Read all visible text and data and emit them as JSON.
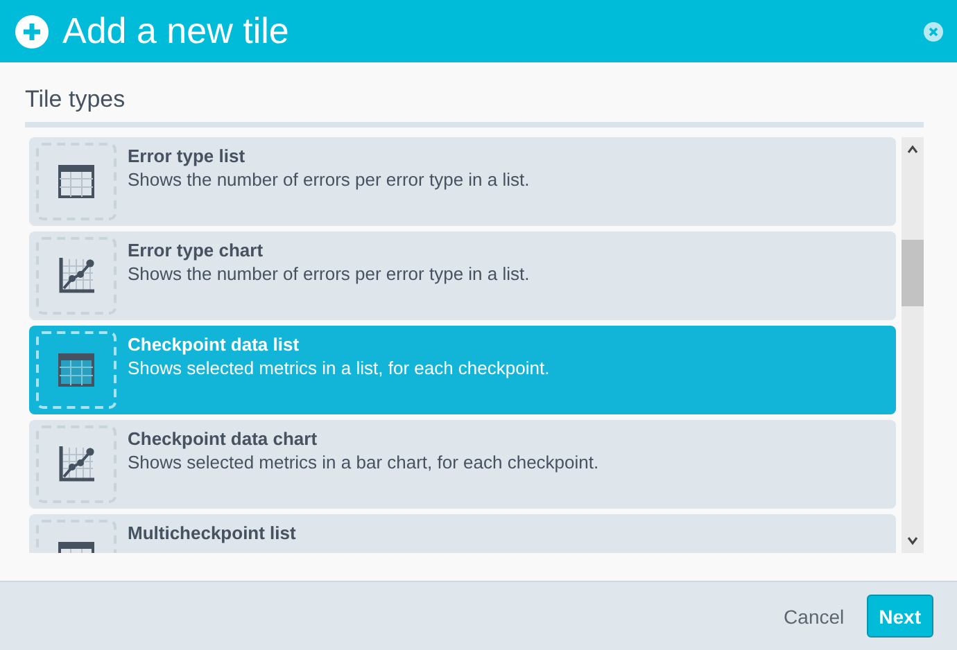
{
  "window": {
    "title": "Add a new tile"
  },
  "section": {
    "title": "Tile types"
  },
  "tiles": [
    {
      "kind": "list",
      "title": "Error type list",
      "description": "Shows the number of errors per error type in a list.",
      "selected": false
    },
    {
      "kind": "chart",
      "title": "Error type chart",
      "description": "Shows the number of errors per error type in a list.",
      "selected": false
    },
    {
      "kind": "list",
      "title": "Checkpoint data list",
      "description": "Shows selected metrics in a list, for each checkpoint.",
      "selected": true
    },
    {
      "kind": "chart",
      "title": "Checkpoint data chart",
      "description": "Shows selected metrics in a bar chart, for each checkpoint.",
      "selected": false
    },
    {
      "kind": "list",
      "title": "Multicheckpoint list",
      "selected": false
    }
  ],
  "buttons": {
    "cancel": "Cancel",
    "next": "Next"
  }
}
